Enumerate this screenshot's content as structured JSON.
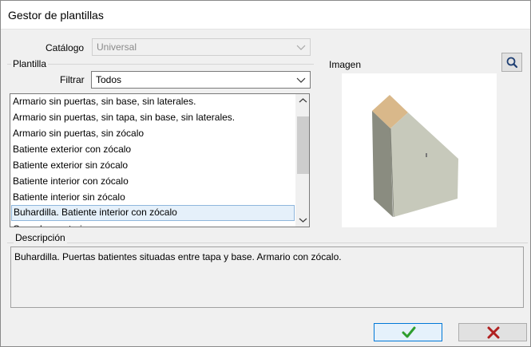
{
  "window": {
    "title": "Gestor de plantillas"
  },
  "catalog": {
    "label": "Catálogo",
    "value": "Universal"
  },
  "template": {
    "group_label": "Plantilla",
    "filter_label": "Filtrar",
    "filter_value": "Todos",
    "items": [
      "Armario sin puertas, sin base, sin laterales.",
      "Armario sin puertas, sin tapa, sin base, sin laterales.",
      "Armario sin puertas, sin zócalo",
      "Batiente exterior con zócalo",
      "Batiente exterior sin zócalo",
      "Batiente interior con zócalo",
      "Batiente interior sin zócalo",
      "Buhardilla. Batiente interior con zócalo",
      "Corredera exterior"
    ],
    "selected_index": 7
  },
  "image": {
    "label": "Imagen"
  },
  "description": {
    "label": "Descripción",
    "text": "Buhardilla. Puertas batientes situadas entre tapa y base. Armario con zócalo."
  },
  "colors": {
    "ok_check": "#2e9e2e",
    "cancel_x": "#b02020",
    "selection_bg": "#e5f0fa",
    "cabinet_front": "#c7c9bb",
    "cabinet_side": "#8a8c80",
    "cabinet_top": "#d9b88a"
  },
  "icons": {
    "search": "search-icon",
    "ok": "check-icon",
    "cancel": "x-icon",
    "dropdown": "chevron-down-icon"
  }
}
